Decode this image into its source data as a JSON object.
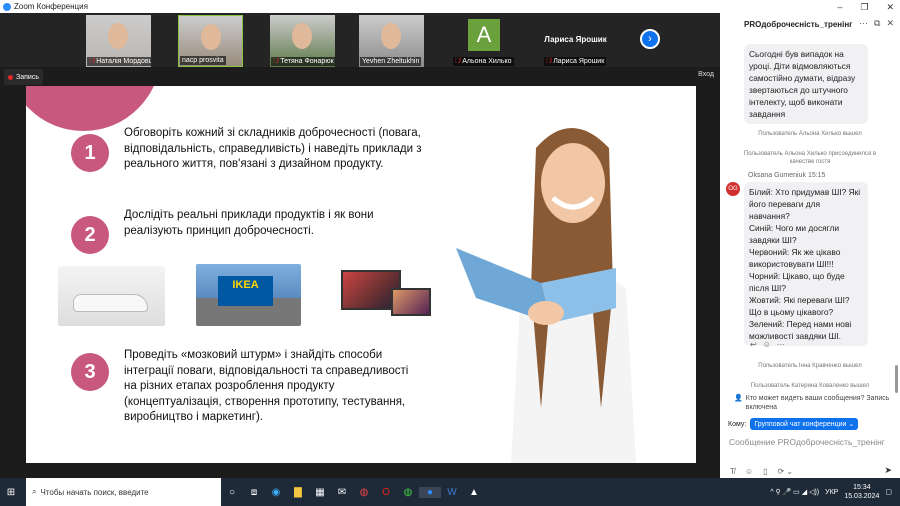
{
  "window": {
    "title": "Zoom Конференция"
  },
  "participants": [
    {
      "name": "Наталія Мордовцева",
      "muted": true,
      "color": "#b9b4b0"
    },
    {
      "name": "nacp prosvita",
      "muted": false,
      "color": "#9a8c7c"
    },
    {
      "name": "Тетяна Фонарюк",
      "muted": true,
      "color": "#5d7a4a"
    },
    {
      "name": "Yevhen Zheltukhin",
      "muted": false,
      "color": "#8c8c8c"
    },
    {
      "name": "Альона Хилько",
      "muted": true,
      "initial": "A",
      "color": "#6aa13c"
    },
    {
      "name": "Лариса Ярошик",
      "muted": true,
      "display": "Лариса Ярошик"
    }
  ],
  "recording": {
    "label": "Запись"
  },
  "exit_label": "Вход",
  "slide": {
    "items": [
      {
        "num": "1",
        "text": "Обговоріть кожний зі складників доброчесності (повага, відповідальність, справедливість) і наведіть приклади з реального життя, пов'язані з дизайном продукту."
      },
      {
        "num": "2",
        "text": "Дослідіть реальні приклади продуктів і як вони реалізують принцип доброчесності."
      },
      {
        "num": "3",
        "text": "Проведіть «мозковий штурм» і знайдіть способи інтеграції поваги, відповідальності та справедливості на різних етапах розроблення продукту (концептуалізація, створення прототипу, тестування, виробництво і маркетинг)."
      }
    ],
    "ikea_sign": "IKEA",
    "accent": "#c8587d"
  },
  "chat": {
    "title": "PROдоброчесність_тренінг",
    "messages": [
      {
        "text": "Сьогодні був випадок на уроці. Діти відмовляються самостійно думати, відразу звертаються до штучного інтелекту, щоб виконати завдання"
      },
      {
        "system": "Пользователь Альона Хилько вышел"
      },
      {
        "system": "Пользователь Альона Хилько присоединился в качестве гостя"
      },
      {
        "sender": "Oksana Gumeniuk",
        "time": "15:15",
        "avatar": "OG",
        "text": "Білий: Хто придумав ШІ? Які його переваги для навчання?\nСиній: Чого ми досягли завдяки ШІ?\nЧервоний: Як же цікаво використовувати ШІ!!!\nЧорний: Цікаво, що буде після ШІ?\nЖовтий: Які переваги ШІ? Що в цьому цікавого?\nЗелений: Перед нами нові можливості завдяки ШІ."
      },
      {
        "system": "Пользователь Інна Кравченко вышел"
      },
      {
        "system": "Пользователь Катерина Коваленко вышел"
      }
    ],
    "privacy": "Кто может видеть ваши сообщения? Запись включена",
    "to_label": "Кому:",
    "to_value": "Групповой чат конференции ⌄",
    "placeholder": "Сообщение PROдоброчесність_тренінг"
  },
  "taskbar": {
    "search_placeholder": "Чтобы начать поиск, введите",
    "lang": "УКР",
    "time": "15:34",
    "date": "15.03.2024"
  }
}
